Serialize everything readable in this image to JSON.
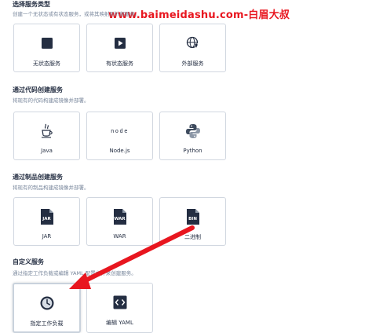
{
  "watermark": "www.baimeidashu.com-白眉大叔",
  "sections": {
    "service_type": {
      "title": "选择服务类型",
      "desc": "创建一个无状态或有状态服务，或将其映射到外部服务。"
    },
    "code": {
      "title": "通过代码创建服务",
      "desc": "将现有的代码构建成镜像并部署。"
    },
    "artifact": {
      "title": "通过制品创建服务",
      "desc": "将现有的制品构建成镜像并部署。"
    },
    "custom": {
      "title": "自定义服务",
      "desc": "通过指定工作负载或编辑 YAML 配置文件来创建服务。"
    }
  },
  "cards": {
    "stateless": "无状态服务",
    "stateful": "有状态服务",
    "external": "外部服务",
    "java": "Java",
    "nodejs": "Node.js",
    "python": "Python",
    "jar": "JAR",
    "war": "WAR",
    "binary": "二进制",
    "workload": "指定工作负载",
    "yaml": "编辑 YAML"
  },
  "icon_text": {
    "node": "node",
    "jar": "JAR",
    "war": "WAR",
    "bin": "BIN"
  },
  "icons": {
    "stateless": "square-icon",
    "stateful": "play-box-icon",
    "external": "globe-pin-icon",
    "java": "java-cup-icon",
    "nodejs": "nodejs-icon",
    "python": "python-icon",
    "jar": "jar-file-icon",
    "war": "war-file-icon",
    "binary": "bin-file-icon",
    "workload": "clock-icon",
    "yaml": "code-file-icon"
  },
  "colors": {
    "icon_dark": "#242e42",
    "watermark": "#e8161f",
    "arrow": "#e8161f",
    "border": "#d1d7e0"
  }
}
